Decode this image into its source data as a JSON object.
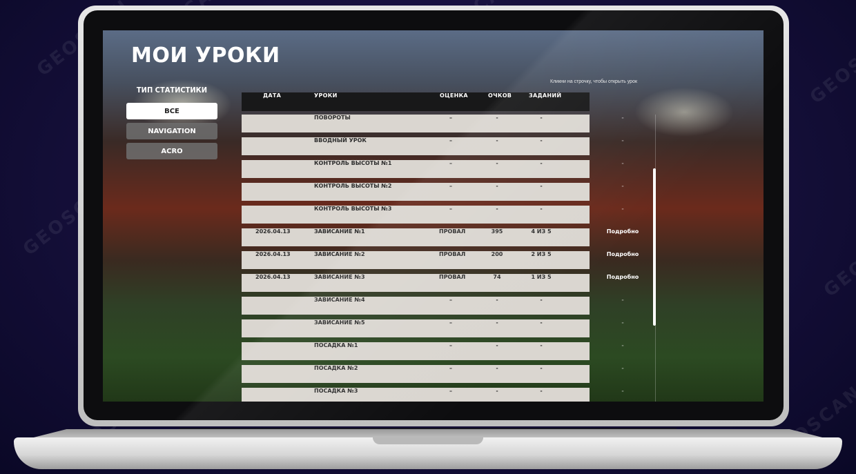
{
  "watermark": "GEOSCAN",
  "page": {
    "title": "МОИ УРОКИ",
    "hint": "Кликни на строчку, чтобы открыть урок"
  },
  "filter": {
    "label": "ТИП СТАТИСТИКИ",
    "options": [
      {
        "label": "ВСЕ",
        "active": true
      },
      {
        "label": "NAVIGATION",
        "active": false
      },
      {
        "label": "ACRO",
        "active": false
      }
    ]
  },
  "table": {
    "headers": {
      "date": "ДАТА",
      "lesson": "УРОКИ",
      "grade": "ОЦЕНКА",
      "points": "ОЧКОВ",
      "tasks": "ЗАДАНИЙ"
    },
    "rows": [
      {
        "date": "",
        "lesson": "ПОВОРОТЫ",
        "grade": "–",
        "points": "-",
        "tasks": "-",
        "details": "-"
      },
      {
        "date": "",
        "lesson": "ВВОДНЫЙ УРОК",
        "grade": "–",
        "points": "-",
        "tasks": "-",
        "details": "-"
      },
      {
        "date": "",
        "lesson": "КОНТРОЛЬ ВЫСОТЫ №1",
        "grade": "–",
        "points": "-",
        "tasks": "-",
        "details": "-"
      },
      {
        "date": "",
        "lesson": "КОНТРОЛЬ ВЫСОТЫ №2",
        "grade": "–",
        "points": "-",
        "tasks": "-",
        "details": "-"
      },
      {
        "date": "",
        "lesson": "КОНТРОЛЬ ВЫСОТЫ №3",
        "grade": "–",
        "points": "-",
        "tasks": "-",
        "details": "-"
      },
      {
        "date": "2026.04.13",
        "lesson": "ЗАВИСАНИЕ №1",
        "grade": "ПРОВАЛ",
        "points": "395",
        "tasks": "4 ИЗ 5",
        "details": "Подробно"
      },
      {
        "date": "2026.04.13",
        "lesson": "ЗАВИСАНИЕ №2",
        "grade": "ПРОВАЛ",
        "points": "200",
        "tasks": "2 ИЗ 5",
        "details": "Подробно"
      },
      {
        "date": "2026.04.13",
        "lesson": "ЗАВИСАНИЕ №3",
        "grade": "ПРОВАЛ",
        "points": "74",
        "tasks": "1 ИЗ 5",
        "details": "Подробно"
      },
      {
        "date": "",
        "lesson": "ЗАВИСАНИЕ №4",
        "grade": "–",
        "points": "-",
        "tasks": "-",
        "details": "-"
      },
      {
        "date": "",
        "lesson": "ЗАВИСАНИЕ №5",
        "grade": "–",
        "points": "-",
        "tasks": "-",
        "details": "-"
      },
      {
        "date": "",
        "lesson": "ПОСАДКА №1",
        "grade": "–",
        "points": "-",
        "tasks": "-",
        "details": "-"
      },
      {
        "date": "",
        "lesson": "ПОСАДКА №2",
        "grade": "–",
        "points": "-",
        "tasks": "-",
        "details": "-"
      },
      {
        "date": "",
        "lesson": "ПОСАДКА №3",
        "grade": "–",
        "points": "-",
        "tasks": "-",
        "details": "-"
      }
    ]
  }
}
